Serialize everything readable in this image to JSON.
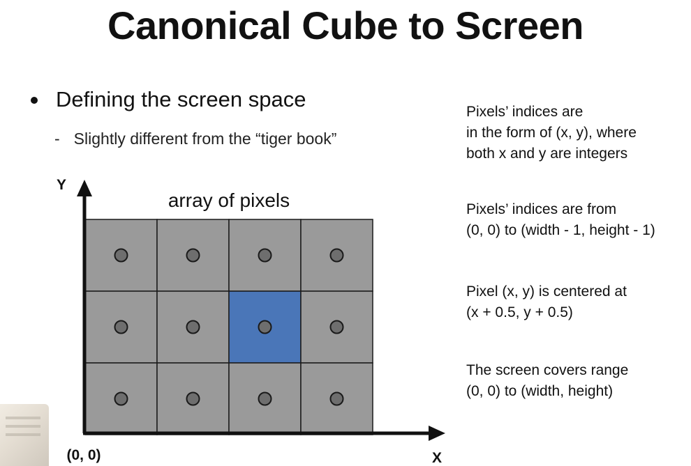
{
  "title": "Canonical Cube to Screen",
  "bullet": {
    "text": "Defining the screen space",
    "sub_text": "Slightly different from the “tiger book”"
  },
  "diagram": {
    "y_axis_label": "Y",
    "x_axis_label": "X",
    "origin_label": "(0, 0)",
    "grid_caption": "array of pixels",
    "rows": 3,
    "cols": 4,
    "highlighted_cell": {
      "row": 1,
      "col": 2
    },
    "colors": {
      "pixel_fill": "#9a9a9a",
      "pixel_border": "#1a1a1a",
      "highlight_fill": "#4a76b8",
      "center_dot_fill": "#6e6e6e",
      "axis": "#111111"
    }
  },
  "notes": [
    {
      "lines": [
        "Pixels’ indices are",
        "in the form of (x, y), where",
        "both x and y are integers"
      ]
    },
    {
      "lines": [
        "Pixels’ indices are from",
        "(0, 0) to (width - 1, height - 1)"
      ]
    },
    {
      "lines": [
        "Pixel (x, y) is centered at",
        "(x + 0.5, y + 0.5)"
      ]
    },
    {
      "lines": [
        "The screen covers range",
        "(0, 0) to (width, height)"
      ]
    }
  ]
}
